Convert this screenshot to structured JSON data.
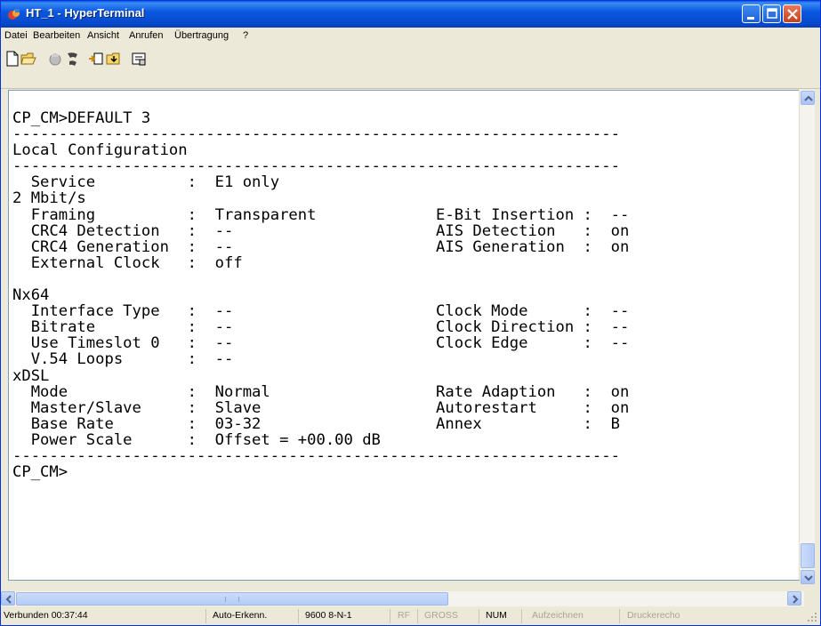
{
  "window": {
    "title": "HT_1 - HyperTerminal"
  },
  "menu": [
    "Datei",
    "Bearbeiten",
    "Ansicht",
    "Anrufen",
    "Übertragung",
    "?"
  ],
  "toolbar": [
    "new-icon",
    "open-icon",
    "disconnect-icon",
    "connect-icon",
    "send-icon",
    "receive-icon",
    "properties-icon"
  ],
  "terminal": {
    "lines": [
      "CP_CM>DEFAULT 3",
      "------------------------------------------------------------------",
      "Local Configuration",
      "------------------------------------------------------------------",
      "  Service          :  E1 only",
      "2 Mbit/s",
      "  Framing          :  Transparent             E-Bit Insertion :  --",
      "  CRC4 Detection   :  --                      AIS Detection   :  on",
      "  CRC4 Generation  :  --                      AIS Generation  :  on",
      "  External Clock   :  off",
      "",
      "Nx64",
      "  Interface Type   :  --                      Clock Mode      :  --",
      "  Bitrate          :  --                      Clock Direction :  --",
      "  Use Timeslot 0   :  --                      Clock Edge      :  --",
      "  V.54 Loops       :  --",
      "xDSL",
      "  Mode             :  Normal                  Rate Adaption   :  on",
      "  Master/Slave     :  Slave                   Autorestart     :  on",
      "  Base Rate        :  03-32                   Annex           :  B",
      "  Power Scale      :  Offset = +00.00 dB",
      "------------------------------------------------------------------",
      "CP_CM>"
    ]
  },
  "status": {
    "connection": "Verbunden 00:37:44",
    "detect": "Auto-Erkenn.",
    "params": "9600 8-N-1",
    "rf": "RF",
    "caps": "GROSS",
    "num": "NUM",
    "record": "Aufzeichnen",
    "print_echo": "Druckerecho"
  }
}
